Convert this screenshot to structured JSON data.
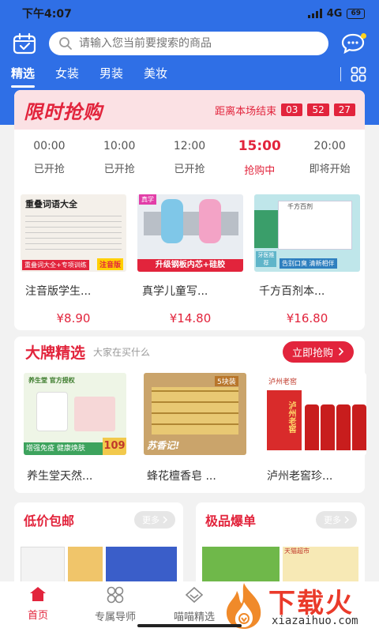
{
  "status": {
    "time": "下午4:07",
    "network": "4G",
    "battery": "69"
  },
  "search": {
    "placeholder": "请输入您当前要搜索的商品"
  },
  "tabs": [
    "精选",
    "女装",
    "男装",
    "美妆"
  ],
  "flash": {
    "title": "限时抢购",
    "countdown_label": "距离本场结束",
    "countdown": [
      "03",
      "52",
      "27"
    ],
    "slots": [
      {
        "time": "00:00",
        "status": "已开抢"
      },
      {
        "time": "10:00",
        "status": "已开抢"
      },
      {
        "time": "12:00",
        "status": "已开抢"
      },
      {
        "time": "15:00",
        "status": "抢购中"
      },
      {
        "time": "20:00",
        "status": "即将开始"
      }
    ],
    "products": [
      {
        "name": "注音版学生...",
        "price": "¥8.90",
        "img_title": "重叠词语大全",
        "img_tag": "注音版",
        "img_foot": "重叠词大全+专项训练"
      },
      {
        "name": "真学儿童写...",
        "price": "¥14.80",
        "img_title": "真学",
        "img_foot": "升级钢板内芯+硅胶"
      },
      {
        "name": "千方百剂本...",
        "price": "¥16.80",
        "img_title": "千方百剂",
        "img_foot": "告别口臭 清新相伴",
        "img_side": "牙医推荐"
      }
    ]
  },
  "brand": {
    "title": "大牌精选",
    "subtitle": "大家在买什么",
    "button": "立即抢购",
    "products": [
      {
        "name": "养生堂天然...",
        "img_top": "养生堂  官方授权",
        "img_foot": "增强免疫 健康焕肤",
        "img_price": "109"
      },
      {
        "name": "蜂花檀香皂 ...",
        "img_top": "5块装",
        "img_foot": "苏香记!"
      },
      {
        "name": "泸州老窖珍...",
        "img_top": "泸州老窖",
        "img_foot": "泸州老窖"
      }
    ]
  },
  "bottom_cards": [
    {
      "title": "低价包邮",
      "more": "更多"
    },
    {
      "title": "极品爆单",
      "more": "更多",
      "img_tag": "天猫超市"
    }
  ],
  "nav": [
    {
      "label": "首页"
    },
    {
      "label": "专属导师"
    },
    {
      "label": "喵喵精选"
    }
  ],
  "watermark": {
    "brand": "下载火",
    "url": "xiazaihuo.com"
  },
  "colors": {
    "header_blue": "#2f6fe6",
    "accent_red": "#e2243c",
    "flash_bg": "#fbe1e4"
  }
}
